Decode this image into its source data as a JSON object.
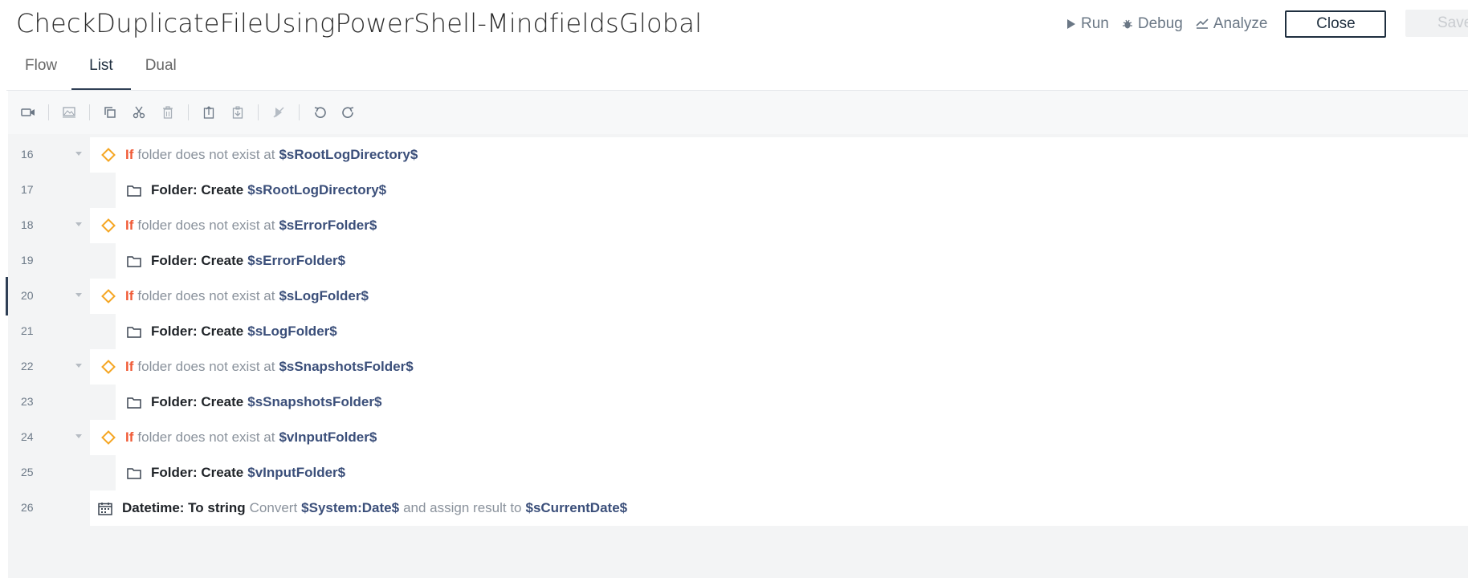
{
  "header": {
    "title": "CheckDuplicateFileUsingPowerShell-MindfieldsGlobal",
    "run_label": "Run",
    "debug_label": "Debug",
    "analyze_label": "Analyze",
    "close_label": "Close",
    "save_label": "Save"
  },
  "tabs": [
    {
      "label": "Flow"
    },
    {
      "label": "List"
    },
    {
      "label": "Dual"
    }
  ],
  "colors": {
    "accent_dark": "#1f2f3f",
    "if_keyword": "#f05a36",
    "condition_diamond": "#f5a623",
    "variable": "#3b4f7a"
  },
  "rows": [
    {
      "line": "16",
      "kw": "If",
      "text": "folder does not exist at",
      "var": "$sRootLogDirectory$"
    },
    {
      "line": "17",
      "action": "Folder: Create",
      "var": "$sRootLogDirectory$"
    },
    {
      "line": "18",
      "kw": "If",
      "text": "folder does not exist at",
      "var": "$sErrorFolder$"
    },
    {
      "line": "19",
      "action": "Folder: Create",
      "var": "$sErrorFolder$"
    },
    {
      "line": "20",
      "kw": "If",
      "text": "folder does not exist at",
      "var": "$sLogFolder$"
    },
    {
      "line": "21",
      "action": "Folder: Create",
      "var": "$sLogFolder$"
    },
    {
      "line": "22",
      "kw": "If",
      "text": "folder does not exist at",
      "var": "$sSnapshotsFolder$"
    },
    {
      "line": "23",
      "action": "Folder: Create",
      "var": "$sSnapshotsFolder$"
    },
    {
      "line": "24",
      "kw": "If",
      "text": "folder does not exist at",
      "var": "$vInputFolder$"
    },
    {
      "line": "25",
      "action": "Folder: Create",
      "var": "$vInputFolder$"
    },
    {
      "line": "26",
      "action": "Datetime: To string",
      "text": "Convert",
      "var": "$System:Date$",
      "text2": "and assign result to",
      "var2": "$sCurrentDate$"
    }
  ]
}
